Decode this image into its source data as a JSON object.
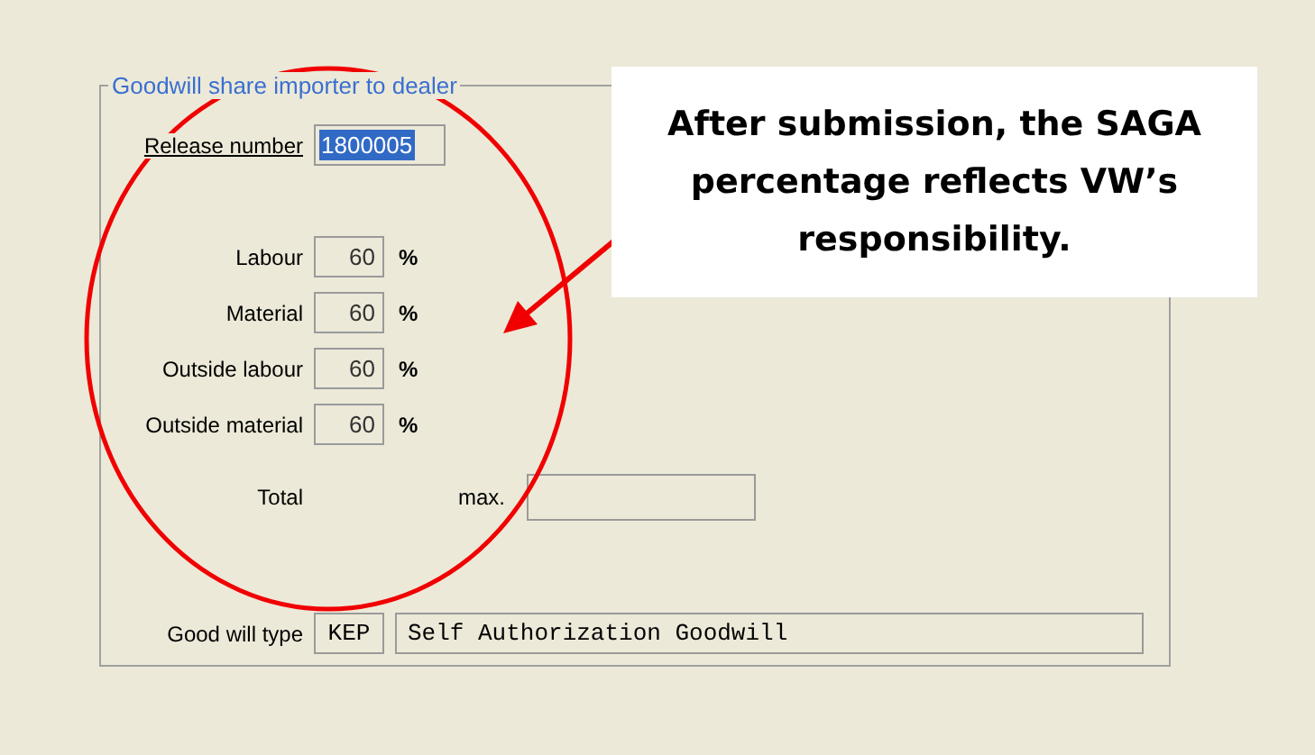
{
  "group": {
    "title": "Goodwill share importer to dealer"
  },
  "release_number": {
    "label": "Release number",
    "value": "1800005",
    "selected": true
  },
  "shares": [
    {
      "label": "Labour",
      "value": "60",
      "unit": "%"
    },
    {
      "label": "Material",
      "value": "60",
      "unit": "%"
    },
    {
      "label": "Outside labour",
      "value": "60",
      "unit": "%"
    },
    {
      "label": "Outside material",
      "value": "60",
      "unit": "%"
    }
  ],
  "total": {
    "label": "Total",
    "max_label": "max."
  },
  "goodwill_type": {
    "label": "Good will type",
    "code": "KEP",
    "description": "Self Authorization Goodwill"
  },
  "annotation": {
    "text": "After submission, the SAGA percentage reflects VW’s responsibility."
  }
}
